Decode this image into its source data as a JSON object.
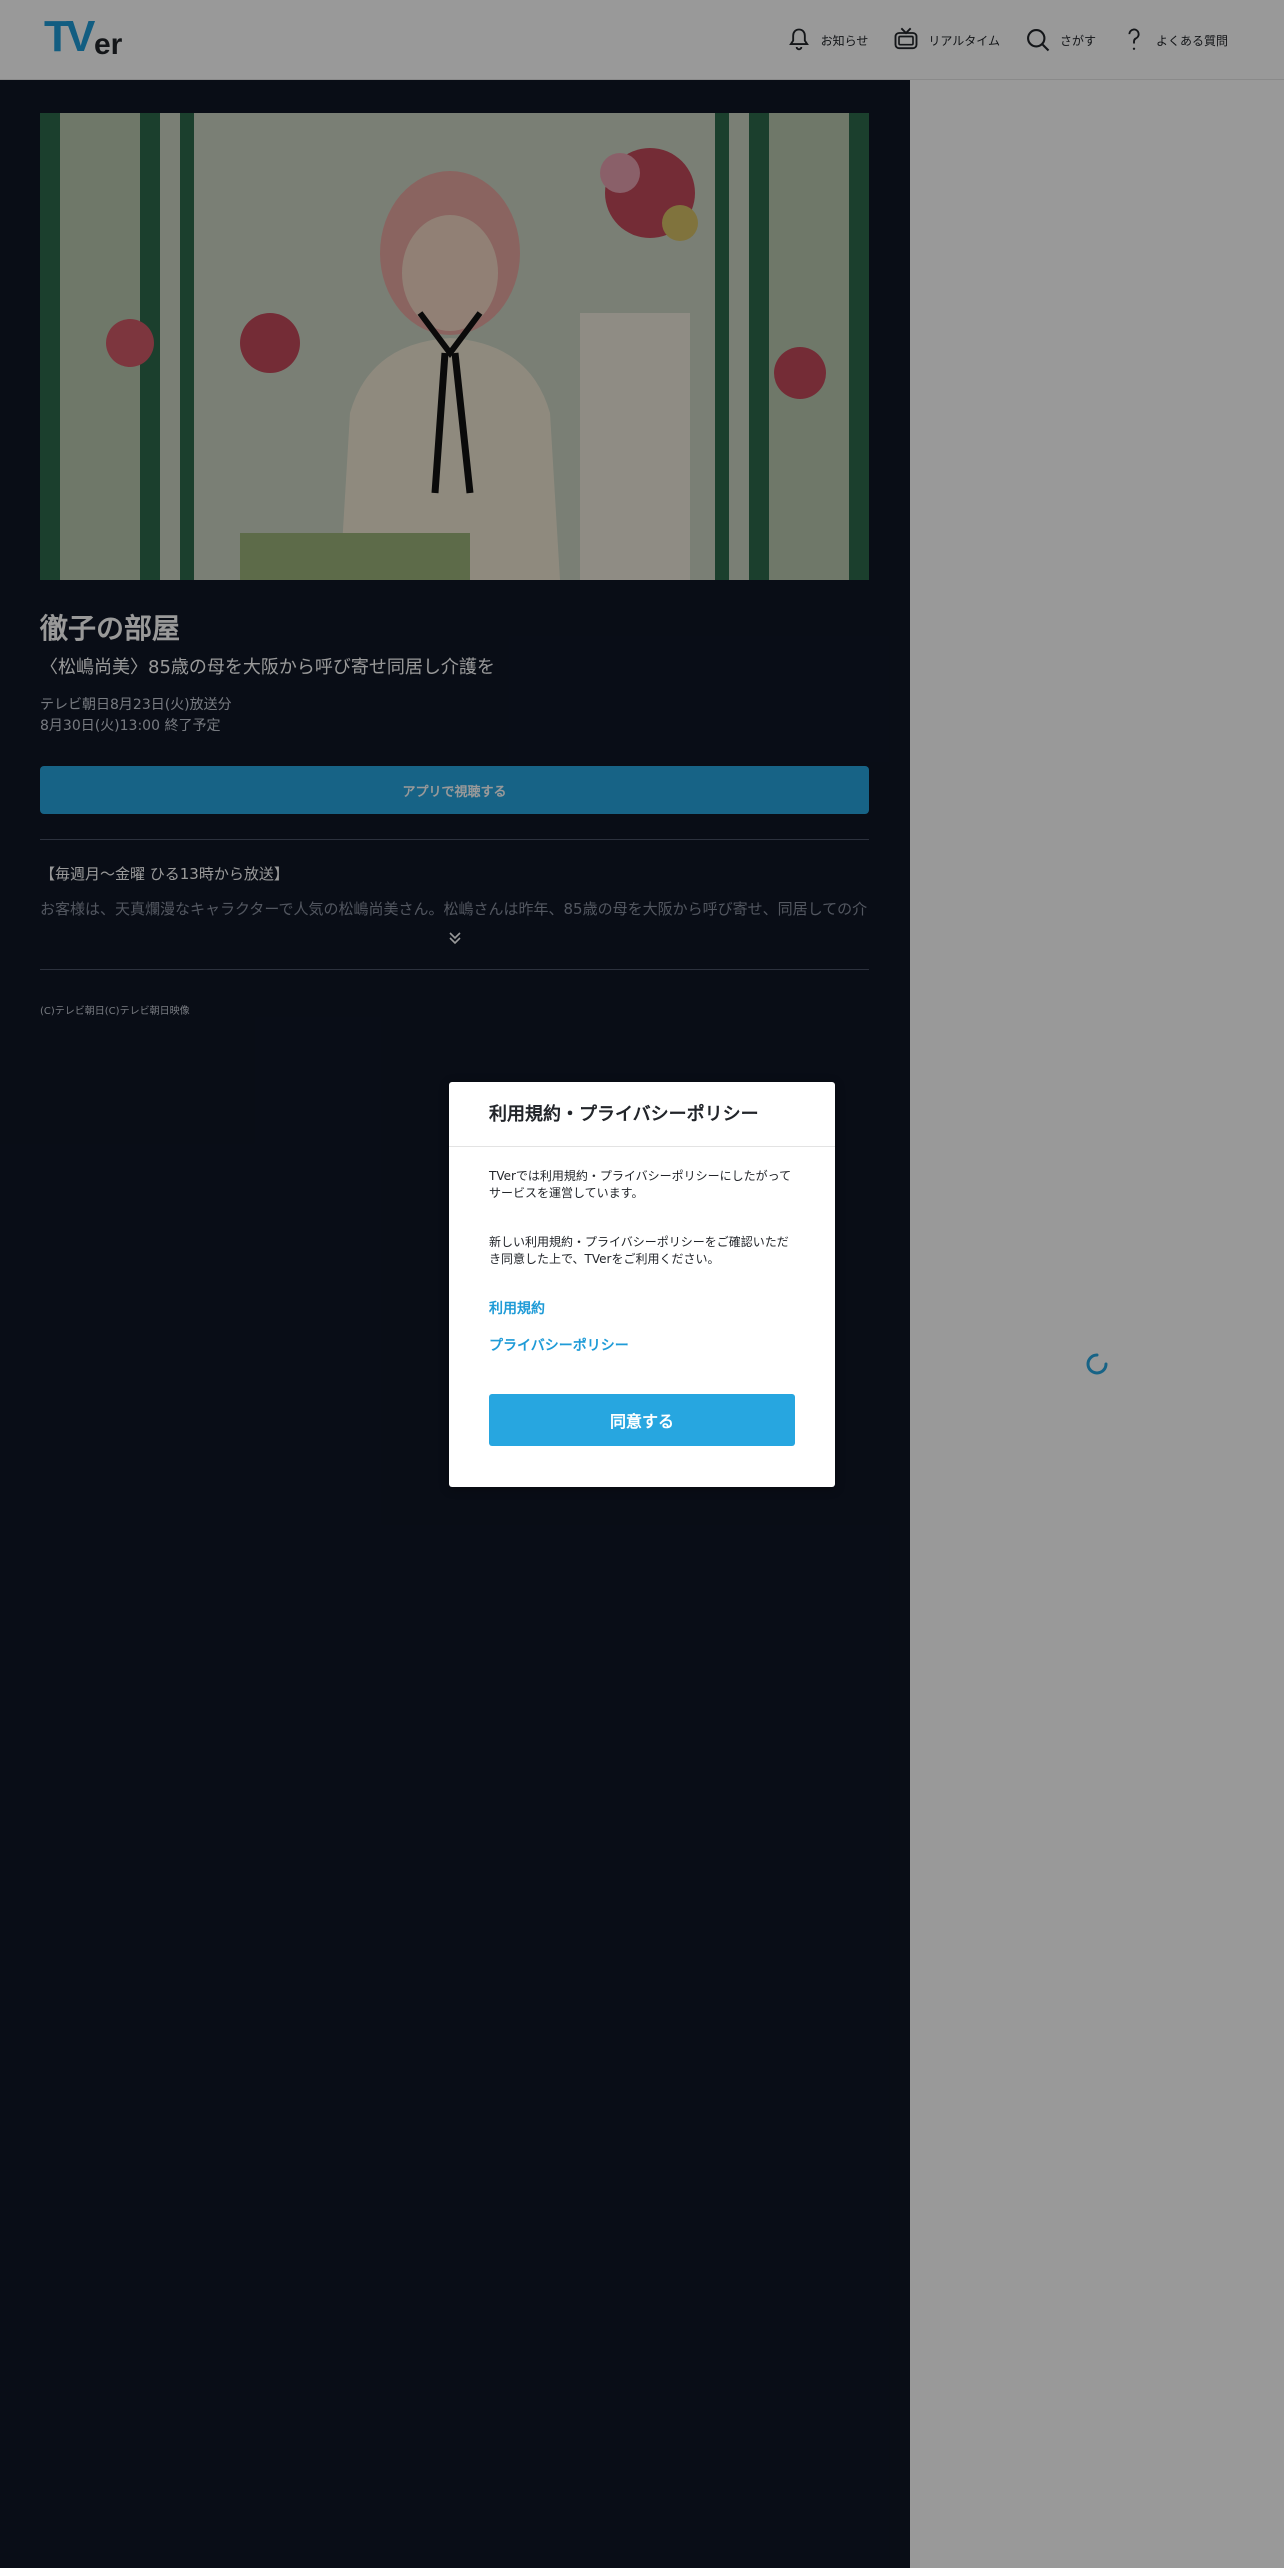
{
  "header": {
    "logo": "TVer",
    "nav": [
      {
        "label": "お知らせ",
        "icon": "bell-icon"
      },
      {
        "label": "リアルタイム",
        "icon": "tv-icon"
      },
      {
        "label": "さがす",
        "icon": "search-icon"
      },
      {
        "label": "よくある質問",
        "icon": "question-icon"
      }
    ]
  },
  "episode": {
    "series_title": "徹子の部屋",
    "episode_title": "〈松嶋尚美〉85歳の母を大阪から呼び寄せ同居し介護を",
    "broadcast": "テレビ朝日8月23日(火)放送分",
    "expiry": "8月30日(火)13:00 終了予定",
    "app_button": "アプリで視聴する",
    "description_head": "【毎週月～金曜 ひる13時から放送】",
    "description_body": "お客様は、天真爛漫なキャラクターで人気の松嶋尚美さん。松嶋さんは昨年、85歳の母を大阪から呼び寄せ、同居しての介",
    "copyright": "(C)テレビ朝日(C)テレビ朝日映像"
  },
  "modal": {
    "title": "利用規約・プライバシーポリシー",
    "paragraph1": "TVerでは利用規約・プライバシーポリシーにしたがってサービスを運営しています。",
    "paragraph2": "新しい利用規約・プライバシーポリシーをご確認いただき同意した上で、TVerをご利用ください。",
    "link_terms": "利用規約",
    "link_privacy": "プライバシーポリシー",
    "agree_button": "同意する"
  },
  "colors": {
    "brand": "#27a6e0",
    "dark_panel": "#0f1626"
  }
}
